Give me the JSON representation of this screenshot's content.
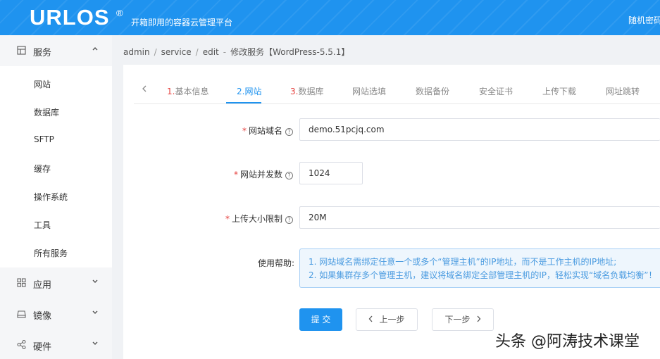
{
  "header": {
    "logo": "URLOS",
    "logo_mark": "®",
    "slogan": "开箱即用的容器云管理平台",
    "right_text": "随机密码"
  },
  "sidebar": {
    "groups": [
      {
        "label": "服务",
        "icon": "grid-icon",
        "chevron": "^"
      },
      {
        "label": "应用",
        "icon": "apps-icon",
        "chevron": "⌄"
      },
      {
        "label": "镜像",
        "icon": "disk-icon",
        "chevron": "⌄"
      },
      {
        "label": "硬件",
        "icon": "share-icon",
        "chevron": "⌄"
      }
    ],
    "items": [
      {
        "label": "网站"
      },
      {
        "label": "数据库"
      },
      {
        "label": "SFTP"
      },
      {
        "label": "缓存"
      },
      {
        "label": "操作系统"
      },
      {
        "label": "工具"
      },
      {
        "label": "所有服务"
      }
    ]
  },
  "breadcrumb": {
    "items": [
      "admin",
      "service",
      "edit",
      "修改服务【WordPress-5.5.1】"
    ],
    "separator": "/",
    "dash": "-"
  },
  "tabs": {
    "items": [
      {
        "num": "1.",
        "label": "基本信息"
      },
      {
        "num": "2.",
        "label": "网站"
      },
      {
        "num": "3.",
        "label": "数据库"
      },
      {
        "num": "",
        "label": "网站选填"
      },
      {
        "num": "",
        "label": "数据备份"
      },
      {
        "num": "",
        "label": "安全证书"
      },
      {
        "num": "",
        "label": "上传下载"
      },
      {
        "num": "",
        "label": "网址跳转"
      }
    ],
    "active_index": 1
  },
  "form": {
    "domain_label": "网站域名",
    "domain_value": "demo.51pcjq.com",
    "concurrency_label": "网站并发数",
    "concurrency_value": "1024",
    "upload_label": "上传大小限制",
    "upload_value": "20M",
    "help_label": "使用帮助:",
    "help_lines": [
      "1. 网站域名需绑定任意一个或多个“管理主机”的IP地址，而不是工作主机的IP地址;",
      "2. 如果集群存多个管理主机，建议将域名绑定全部管理主机的IP，轻松实现“域名负载均衡”！"
    ],
    "required_mark": "*",
    "help_icon": "?"
  },
  "buttons": {
    "submit": "提 交",
    "prev": "上一步",
    "next": "下一步",
    "prev_arrow": "‹",
    "next_arrow": "›"
  },
  "watermark": "头条 @阿涛技术课堂",
  "colors": {
    "primary": "#1f93ef",
    "required": "#e64340",
    "help_text": "#4a9be0"
  }
}
